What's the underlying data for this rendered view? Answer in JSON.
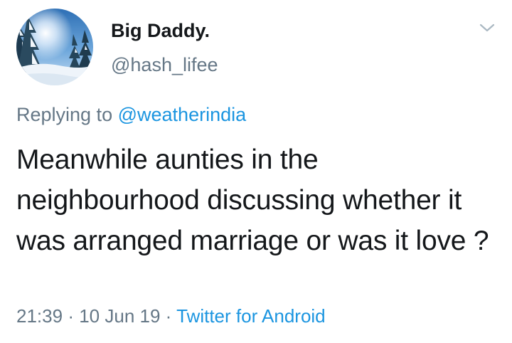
{
  "author": {
    "display_name": "Big Daddy.",
    "handle": "@hash_lifee",
    "avatar_icon": "snowy-forest-avatar"
  },
  "reply": {
    "prefix": "Replying to",
    "mention": "@weatherindia"
  },
  "tweet": {
    "text": "Meanwhile aunties in the neighbourhood discussing whether it was arranged marriage or was it love ?"
  },
  "meta": {
    "time": "21:39",
    "date": "10 Jun 19",
    "separator": "·",
    "source": "Twitter for Android"
  },
  "icons": {
    "menu": "chevron-down-icon"
  },
  "colors": {
    "link": "#1b95e0",
    "secondary_text": "#657786",
    "primary_text": "#14171a"
  }
}
